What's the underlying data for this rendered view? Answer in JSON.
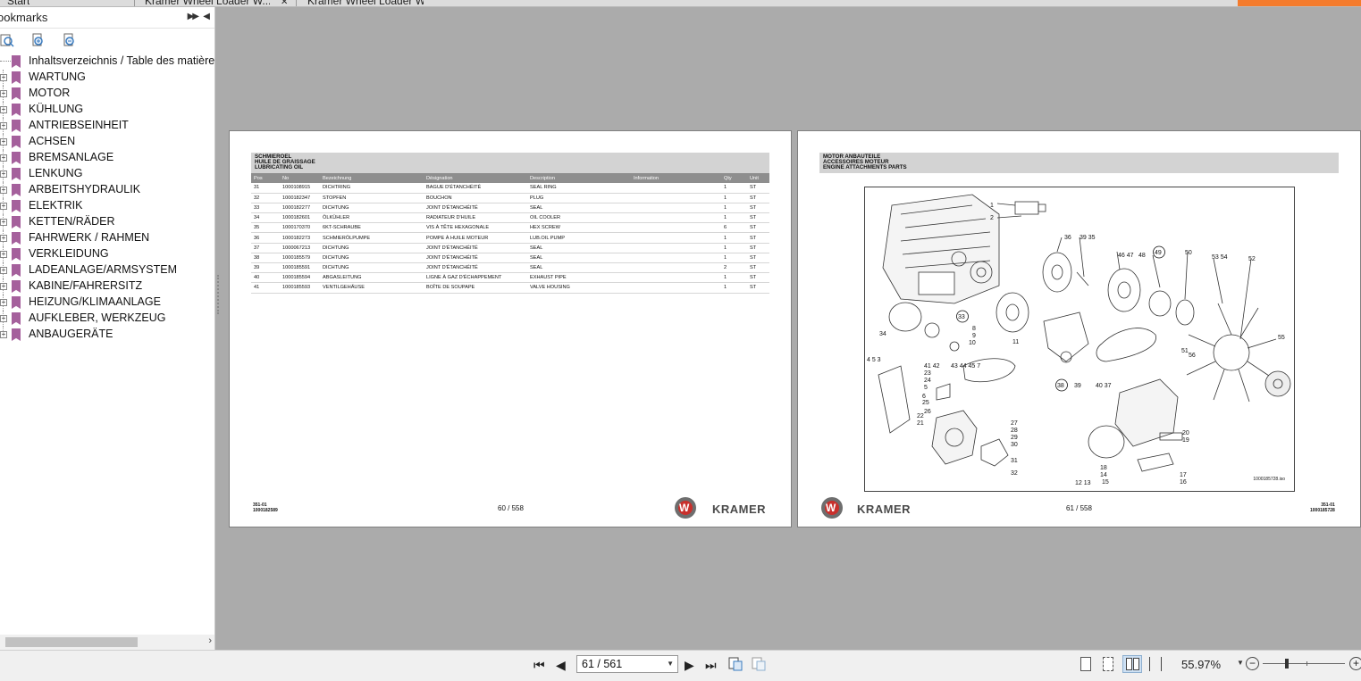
{
  "tabs": [
    {
      "label": "Start"
    },
    {
      "label": "Kramer Wheel Loader W..."
    },
    {
      "label": "Kramer Wheel Loader W..."
    }
  ],
  "sidebar": {
    "title": "ookmarks",
    "items": [
      {
        "label": "Inhaltsverzeichnis / Table des matières",
        "expandable": false
      },
      {
        "label": "WARTUNG",
        "expandable": true
      },
      {
        "label": "MOTOR",
        "expandable": true
      },
      {
        "label": "KÜHLUNG",
        "expandable": true
      },
      {
        "label": "ANTRIEBSEINHEIT",
        "expandable": true
      },
      {
        "label": "ACHSEN",
        "expandable": true
      },
      {
        "label": "BREMSANLAGE",
        "expandable": true
      },
      {
        "label": "LENKUNG",
        "expandable": true
      },
      {
        "label": "ARBEITSHYDRAULIK",
        "expandable": true
      },
      {
        "label": "ELEKTRIK",
        "expandable": true
      },
      {
        "label": "KETTEN/RÄDER",
        "expandable": true
      },
      {
        "label": "FAHRWERK / RAHMEN",
        "expandable": true
      },
      {
        "label": "VERKLEIDUNG",
        "expandable": true
      },
      {
        "label": "LADEANLAGE/ARMSYSTEM",
        "expandable": true
      },
      {
        "label": "KABINE/FAHRERSITZ",
        "expandable": true
      },
      {
        "label": "HEIZUNG/KLIMAANLAGE",
        "expandable": true
      },
      {
        "label": "AUFKLEBER, WERKZEUG",
        "expandable": true
      },
      {
        "label": "ANBAUGERÄTE",
        "expandable": true
      }
    ]
  },
  "left_page": {
    "header": [
      "SCHMIEROEL",
      "HUILE DE GRAISSAGE",
      "LUBRICATING OIL"
    ],
    "columns": [
      "Pos",
      "No",
      "Bezeichnung",
      "Désignation",
      "Description",
      "Information",
      "Qty",
      "Unit"
    ],
    "rows": [
      [
        "31",
        "1000108915",
        "DICHTRING",
        "BAGUE D'ÉTANCHÉITÉ",
        "SEAL RING",
        "",
        "1",
        "ST"
      ],
      [
        "32",
        "1000182347",
        "STOPFEN",
        "BOUCHON",
        "PLUG",
        "",
        "1",
        "ST"
      ],
      [
        "33",
        "1000182277",
        "DICHTUNG",
        "JOINT D'ÉTANCHÉITÉ",
        "SEAL",
        "",
        "1",
        "ST"
      ],
      [
        "34",
        "1000182601",
        "ÖLKÜHLER",
        "RADIATEUR D'HUILE",
        "OIL COOLER",
        "",
        "1",
        "ST"
      ],
      [
        "35",
        "1000170370",
        "6KT-SCHRAUBE",
        "VIS À TÊTE HEXAGONALE",
        "HEX SCREW",
        "",
        "6",
        "ST"
      ],
      [
        "36",
        "1000182273",
        "SCHMIERÖLPUMPE",
        "POMPE À HUILE MOTEUR",
        "LUB.OIL PUMP",
        "",
        "1",
        "ST"
      ],
      [
        "37",
        "1000067213",
        "DICHTUNG",
        "JOINT D'ÉTANCHÉITÉ",
        "SEAL",
        "",
        "1",
        "ST"
      ],
      [
        "38",
        "1000185579",
        "DICHTUNG",
        "JOINT D'ÉTANCHÉITÉ",
        "SEAL",
        "",
        "1",
        "ST"
      ],
      [
        "39",
        "1000185591",
        "DICHTUNG",
        "JOINT D'ÉTANCHÉITÉ",
        "SEAL",
        "",
        "2",
        "ST"
      ],
      [
        "40",
        "1000185594",
        "ABGASLEITUNG",
        "LIGNE À GAZ D'ÉCHAPPEMENT",
        "EXHAUST PIPE",
        "",
        "1",
        "ST"
      ],
      [
        "41",
        "1000185593",
        "VENTILGEHÄUSE",
        "BOÎTE DE SOUPAPE",
        "VALVE HOUSING",
        "",
        "1",
        "ST"
      ]
    ],
    "footer_code": [
      "351-01",
      "1000182589"
    ],
    "page_label": "60 / 558",
    "brand": "KRAMER",
    "logo_letter": "W"
  },
  "right_page": {
    "header": [
      "MOTOR ANBAUTEILE",
      "ACCESSOIRES MOTEUR",
      "ENGINE ATTACHMENTS PARTS"
    ],
    "diagram_code": "1000185728.iso",
    "footer_code": [
      "351-01",
      "1000185728"
    ],
    "page_label": "61 / 558",
    "brand": "KRAMER",
    "logo_letter": "W",
    "callouts": [
      "1",
      "2",
      "36",
      "39 35",
      "46 47",
      "48",
      "49",
      "50",
      "53 54",
      "52",
      "33",
      "34",
      "8",
      "9",
      "10",
      "11",
      "55",
      "51",
      "56",
      "41 42",
      "43 44 45 7",
      "4  5  3",
      "38",
      "39",
      "40 37",
      "23",
      "24",
      "5",
      "6",
      "25",
      "26",
      "22",
      "21",
      "27",
      "28",
      "29",
      "30",
      "31",
      "32",
      "20",
      "19",
      "18",
      "14",
      "15",
      "17",
      "16",
      "12 13"
    ]
  },
  "navbar": {
    "page_input": "61 / 561",
    "zoom": "55.97%"
  },
  "colors": {
    "background": "#ababab",
    "sidebar": "#ffffff",
    "bookmark_icon": "#a5609c",
    "table_header": "#8e8e8e",
    "section_header": "#d3d3d3",
    "brand_red": "#c9302c",
    "accent_orange": "#f47b2c"
  }
}
